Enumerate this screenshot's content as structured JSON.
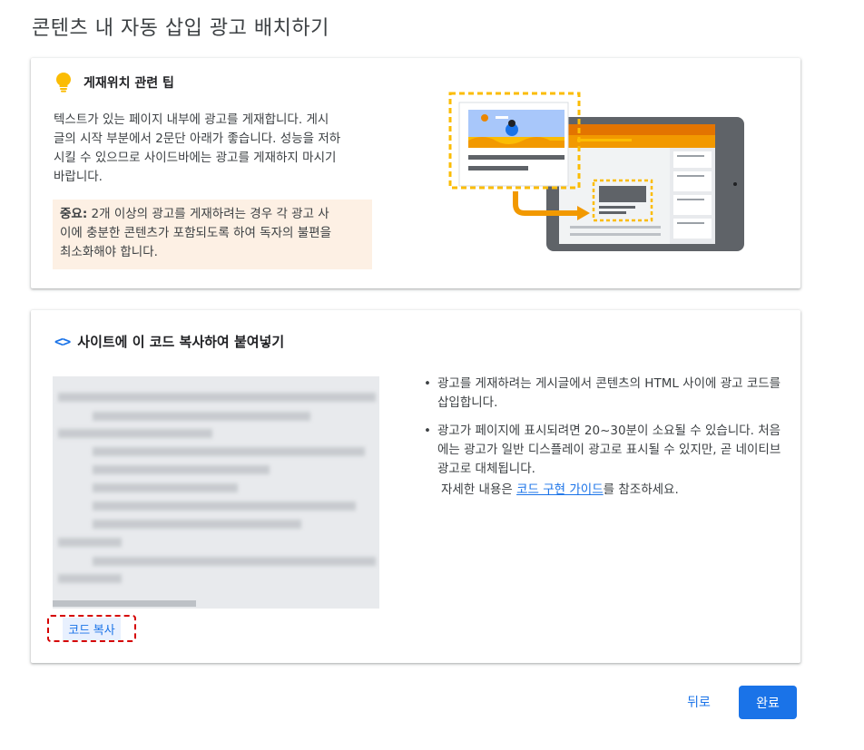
{
  "page": {
    "title": "콘텐츠 내 자동 삽입 광고 배치하기"
  },
  "tips": {
    "title": "게재위치 관련 팁",
    "lines": [
      "텍스트가 있는 페이지 내부에 광고를 게재합니다. 게시",
      "글의 시작 부분에서 2문단 아래가 좋습니다. 성능을 저하",
      "시킬 수 있으므로 사이드바에는 광고를 게재하지 마시기",
      "바랍니다."
    ],
    "notice_label": "중요:",
    "notice_lines": [
      " 2개 이상의 광고를 게재하려는 경우 각 광고 사",
      "이에 충분한 콘텐츠가 포함되도록 하여 독자의 불편을",
      "최소화해야 합니다."
    ],
    "accent_color": "#fbbc04"
  },
  "code_section": {
    "title": "사이트에 이 코드 복사하여 붙여넣기",
    "icon": "code-brackets-icon",
    "copy_button": "코드 복사",
    "bullets": [
      "광고를 게재하려는 게시글에서 콘텐츠의 HTML 사이에 광고 코드를 삽입합니다.",
      "광고가 페이지에 표시되려면 20~30분이 소요될 수 있습니다. 처음에는 광고가 일반 디스플레이 광고로 표시될 수 있지만, 곧 네이티브 광고로 대체됩니다."
    ],
    "guide_prefix": "자세한 내용은 ",
    "guide_link": "코드 구현 가이드",
    "guide_suffix": "를 참조하세요."
  },
  "footer": {
    "back_label": "뒤로",
    "done_label": "완료",
    "primary_color": "#1a73e8"
  }
}
